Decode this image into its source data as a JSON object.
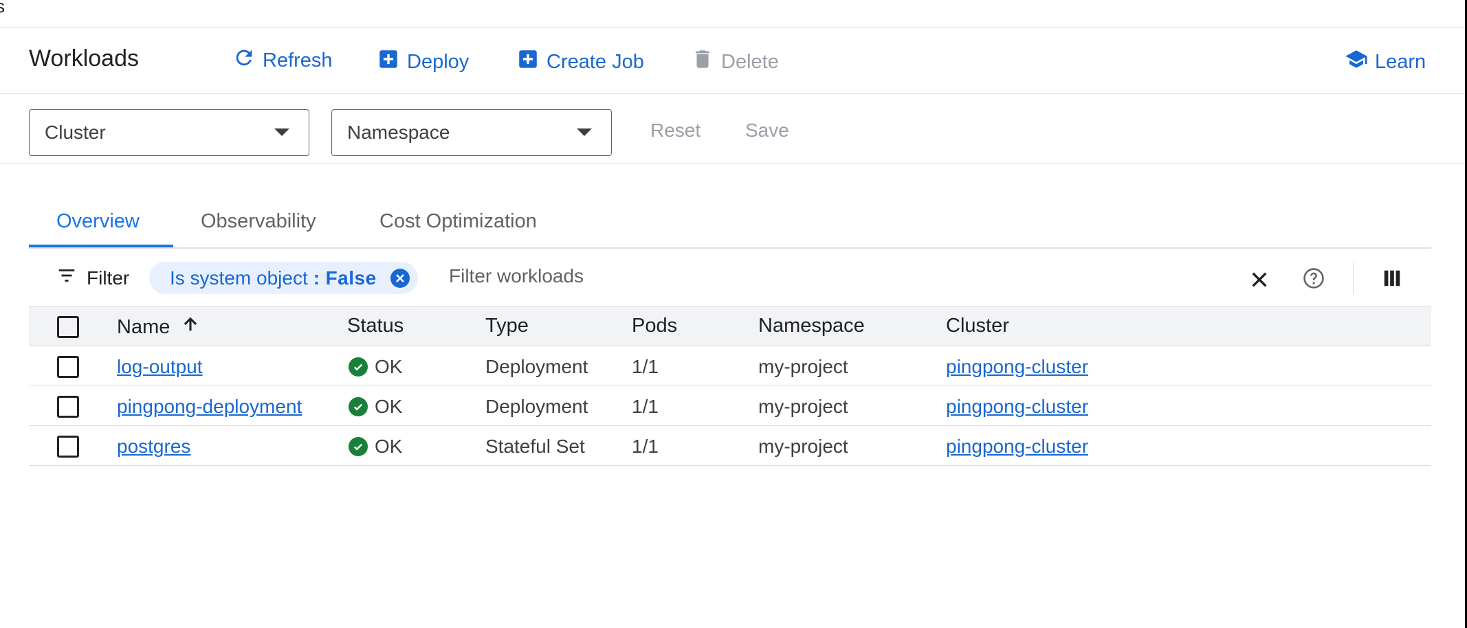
{
  "top_fragment": "s",
  "header": {
    "title": "Workloads",
    "refresh_label": "Refresh",
    "deploy_label": "Deploy",
    "create_job_label": "Create Job",
    "delete_label": "Delete",
    "learn_label": "Learn"
  },
  "filters": {
    "cluster_label": "Cluster",
    "namespace_label": "Namespace",
    "reset_label": "Reset",
    "save_label": "Save"
  },
  "tabs": [
    {
      "label": "Overview",
      "active": true
    },
    {
      "label": "Observability",
      "active": false
    },
    {
      "label": "Cost Optimization",
      "active": false
    }
  ],
  "filterbar": {
    "filter_label": "Filter",
    "chip_key": "Is system object",
    "chip_sep": ":",
    "chip_value": "False",
    "placeholder": "Filter workloads"
  },
  "table": {
    "columns": [
      "Name",
      "Status",
      "Type",
      "Pods",
      "Namespace",
      "Cluster"
    ],
    "sort_icon": "arrow-up-icon",
    "rows": [
      {
        "name": "log-output",
        "status": "OK",
        "type": "Deployment",
        "pods": "1/1",
        "namespace": "my-project",
        "cluster": "pingpong-cluster"
      },
      {
        "name": "pingpong-deployment",
        "status": "OK",
        "type": "Deployment",
        "pods": "1/1",
        "namespace": "my-project",
        "cluster": "pingpong-cluster"
      },
      {
        "name": "postgres",
        "status": "OK",
        "type": "Stateful Set",
        "pods": "1/1",
        "namespace": "my-project",
        "cluster": "pingpong-cluster"
      }
    ]
  },
  "colors": {
    "accent": "#1a73e8",
    "link": "#1967d2",
    "ok": "#188038",
    "disabled": "#9aa0a6",
    "chip_bg": "#e8f0fe"
  }
}
